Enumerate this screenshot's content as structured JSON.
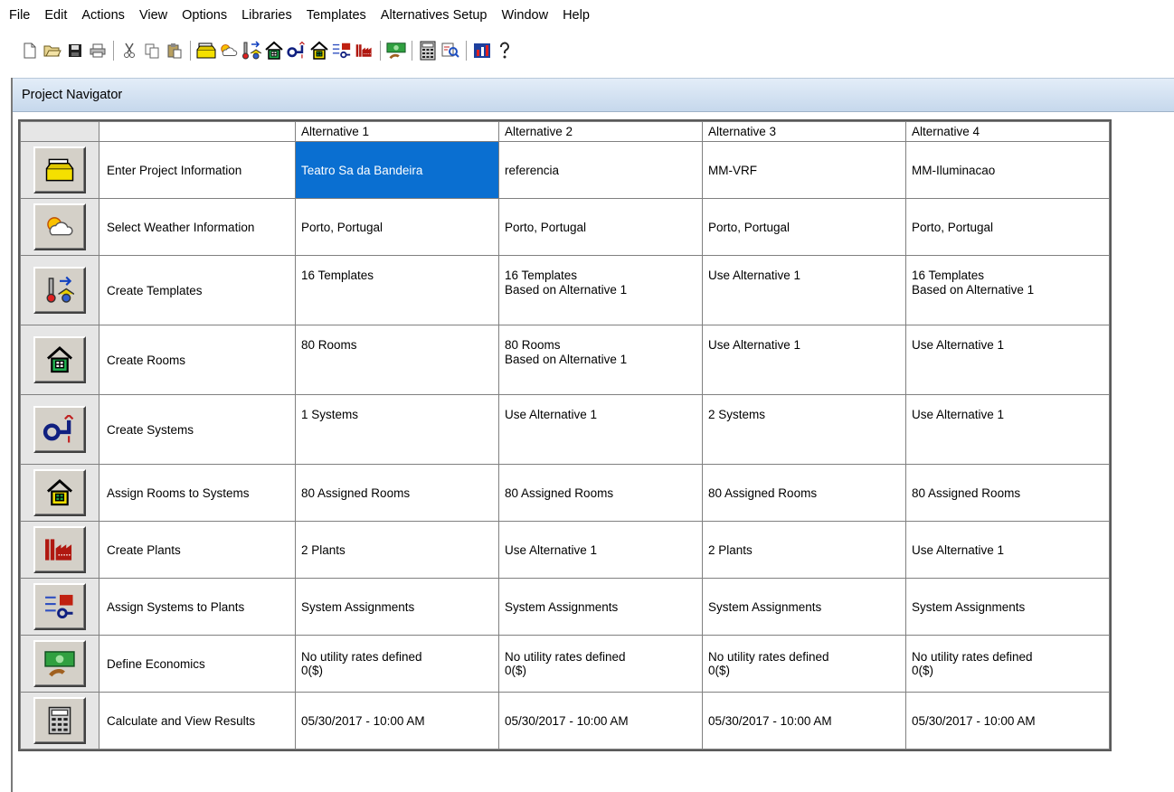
{
  "menu": [
    "File",
    "Edit",
    "Actions",
    "View",
    "Options",
    "Libraries",
    "Templates",
    "Alternatives Setup",
    "Window",
    "Help"
  ],
  "toolbar": {
    "groups": [
      [
        "new-file-icon",
        "open-folder-icon",
        "save-icon",
        "print-icon"
      ],
      [
        "cut-icon",
        "copy-icon",
        "paste-icon"
      ],
      [
        "project-info-icon",
        "weather-icon",
        "templates-icon",
        "rooms-icon",
        "systems-icon",
        "assign-rooms-icon",
        "assign-systems-icon",
        "plants-icon"
      ],
      [
        "economics-icon"
      ],
      [
        "calculator-icon",
        "reports-icon"
      ],
      [
        "chart-icon",
        "help-icon"
      ]
    ]
  },
  "window": {
    "title": "Project Navigator"
  },
  "grid": {
    "columns": [
      "Alternative 1",
      "Alternative 2",
      "Alternative 3",
      "Alternative 4"
    ],
    "rows": [
      {
        "icon": "project-info-icon",
        "label": "Enter Project Information",
        "align": "mid",
        "cells": [
          [
            "Teatro Sa da Bandeira"
          ],
          [
            "referencia"
          ],
          [
            "MM-VRF"
          ],
          [
            "MM-Iluminacao"
          ]
        ]
      },
      {
        "icon": "weather-icon",
        "label": "Select Weather Information",
        "align": "mid",
        "cells": [
          [
            "Porto, Portugal"
          ],
          [
            "Porto, Portugal"
          ],
          [
            "Porto, Portugal"
          ],
          [
            "Porto, Portugal"
          ]
        ]
      },
      {
        "icon": "templates-icon",
        "label": "Create Templates",
        "align": "top",
        "cells": [
          [
            "16 Templates"
          ],
          [
            "16 Templates",
            "Based on Alternative 1"
          ],
          [
            "Use Alternative 1"
          ],
          [
            "16 Templates",
            "Based on Alternative 1"
          ]
        ]
      },
      {
        "icon": "rooms-icon",
        "label": "Create Rooms",
        "align": "top",
        "cells": [
          [
            "80 Rooms"
          ],
          [
            "80 Rooms",
            "Based on Alternative 1"
          ],
          [
            "Use Alternative 1"
          ],
          [
            "Use Alternative 1"
          ]
        ]
      },
      {
        "icon": "systems-icon",
        "label": "Create Systems",
        "align": "top",
        "cells": [
          [
            "1 Systems"
          ],
          [
            "Use Alternative 1"
          ],
          [
            "2 Systems"
          ],
          [
            "Use Alternative 1"
          ]
        ]
      },
      {
        "icon": "assign-rooms-icon",
        "label": "Assign Rooms to Systems",
        "align": "mid",
        "cells": [
          [
            "80 Assigned Rooms"
          ],
          [
            "80 Assigned Rooms"
          ],
          [
            "80 Assigned Rooms"
          ],
          [
            "80 Assigned Rooms"
          ]
        ]
      },
      {
        "icon": "plants-icon",
        "label": "Create Plants",
        "align": "mid",
        "cells": [
          [
            "2 Plants"
          ],
          [
            "Use Alternative 1"
          ],
          [
            "2 Plants"
          ],
          [
            "Use Alternative 1"
          ]
        ]
      },
      {
        "icon": "assign-systems-icon",
        "label": "Assign Systems to Plants",
        "align": "mid",
        "cells": [
          [
            "System Assignments"
          ],
          [
            "System Assignments"
          ],
          [
            "System Assignments"
          ],
          [
            "System Assignments"
          ]
        ]
      },
      {
        "icon": "economics-icon",
        "label": "Define Economics",
        "align": "mid",
        "cells": [
          [
            "No utility rates defined",
            "0($)"
          ],
          [
            "No utility rates defined",
            "0($)"
          ],
          [
            "No utility rates defined",
            "0($)"
          ],
          [
            "No utility rates defined",
            "0($)"
          ]
        ]
      },
      {
        "icon": "calculator-icon",
        "label": "Calculate and View Results",
        "align": "mid",
        "cells": [
          [
            "05/30/2017 - 10:00 AM"
          ],
          [
            "05/30/2017 - 10:00 AM"
          ],
          [
            "05/30/2017 - 10:00 AM"
          ],
          [
            "05/30/2017 - 10:00 AM"
          ]
        ]
      }
    ],
    "selected": {
      "row": 0,
      "col": 0
    },
    "colors": {
      "selection": "#0a6fd1",
      "icon_cell_bg": "#e6e6e6",
      "button_face": "#d4d0c8"
    }
  }
}
